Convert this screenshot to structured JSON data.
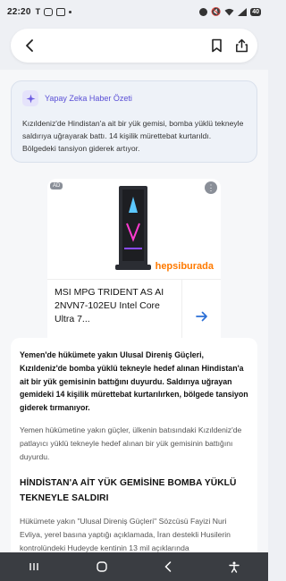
{
  "status_bar": {
    "time": "22:20",
    "left_icons": [
      "text-icon",
      "instagram-icon",
      "gallery-icon",
      "dot-icon"
    ],
    "right_icons": [
      "dnd-icon",
      "mute-icon",
      "wifi-icon",
      "signal-icon"
    ],
    "battery": "40"
  },
  "toolbar": {
    "icons": [
      "back-arrow-icon",
      "bookmark-icon",
      "share-icon"
    ]
  },
  "ai_summary": {
    "title": "Yapay Zeka Haber Özeti",
    "text": "Kızıldeniz'de Hindistan'a ait bir yük gemisi, bomba yüklü tekneyle saldırıya uğrayarak battı. 14 kişilik mürettebat kurtarıldı. Bölgedeki tansiyon giderek artıyor."
  },
  "ad": {
    "tag": "AD",
    "brand": "hepsiburada",
    "product": "MSI MPG TRIDENT AS AI 2NVN7-102EU Intel Core Ultra 7...",
    "colors": {
      "brand": "#ff7a00",
      "arrow": "#2b6fd6"
    }
  },
  "article": {
    "lead": "Yemen'de hükümete yakın Ulusal Direniş Güçleri, Kızıldeniz'de bomba yüklü tekneyle hedef alınan Hindistan'a ait bir yük gemisinin battığını duyurdu. Saldırıya uğrayan gemideki 14 kişilik mürettebat kurtarılırken, bölgede tansiyon giderek tırmanıyor.",
    "paragraph1": "Yemen hükümetine yakın güçler, ülkenin batısındaki Kızıldeniz'de patlayıcı yüklü tekneyle hedef alınan bir yük gemisinin battığını duyurdu.",
    "heading": "HİNDİSTAN'A AİT YÜK GEMİSİNE BOMBA YÜKLÜ TEKNEYLE SALDIRI",
    "paragraph2": "Hükümete yakın \"Ulusal Direniş Güçleri\" Sözcüsü Fayizi Nuri Evliya, yerel basına yaptığı açıklamada, İran destekli Husilerin kontrolündeki Hudeyde kentinin 13 mil açıklarında"
  },
  "nav": {
    "icons": [
      "recents-icon",
      "home-icon",
      "back-icon",
      "accessibility-icon"
    ]
  }
}
